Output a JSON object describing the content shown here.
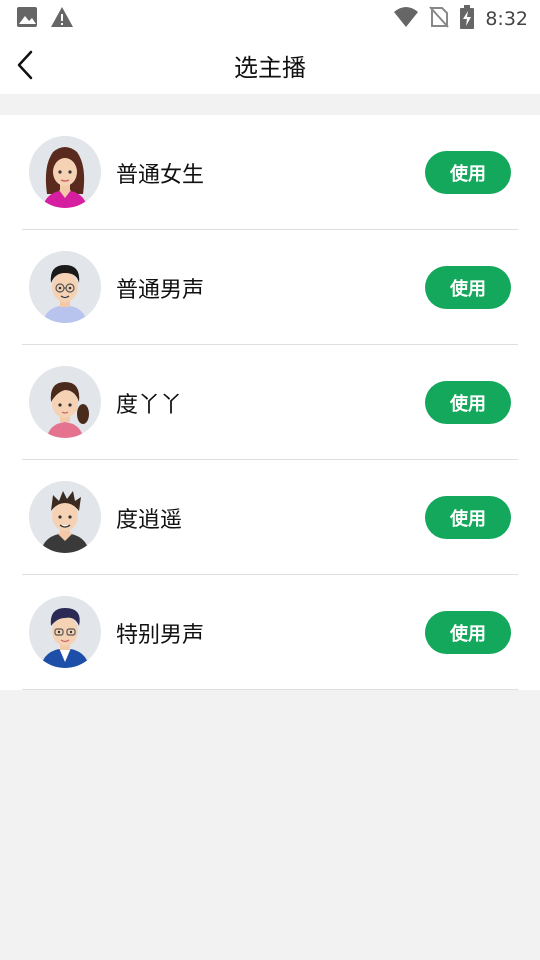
{
  "status_bar": {
    "time": "8:32",
    "left_icons": [
      "image-icon",
      "warning-icon"
    ],
    "right_icons": [
      "wifi-icon",
      "no-sim-icon",
      "battery-charging-icon"
    ]
  },
  "header": {
    "title": "选主播",
    "back_icon": "chevron-left-icon"
  },
  "colors": {
    "accent": "#14a85c",
    "background": "#f2f2f2"
  },
  "anchors": [
    {
      "name": "普通女生",
      "button": "使用",
      "avatar": "female-avatar-long-hair"
    },
    {
      "name": "普通男声",
      "button": "使用",
      "avatar": "male-avatar-glasses"
    },
    {
      "name": "度丫丫",
      "button": "使用",
      "avatar": "girl-avatar-ponytail"
    },
    {
      "name": "度逍遥",
      "button": "使用",
      "avatar": "male-avatar-spiky-hair"
    },
    {
      "name": "特别男声",
      "button": "使用",
      "avatar": "male-avatar-suit"
    }
  ]
}
